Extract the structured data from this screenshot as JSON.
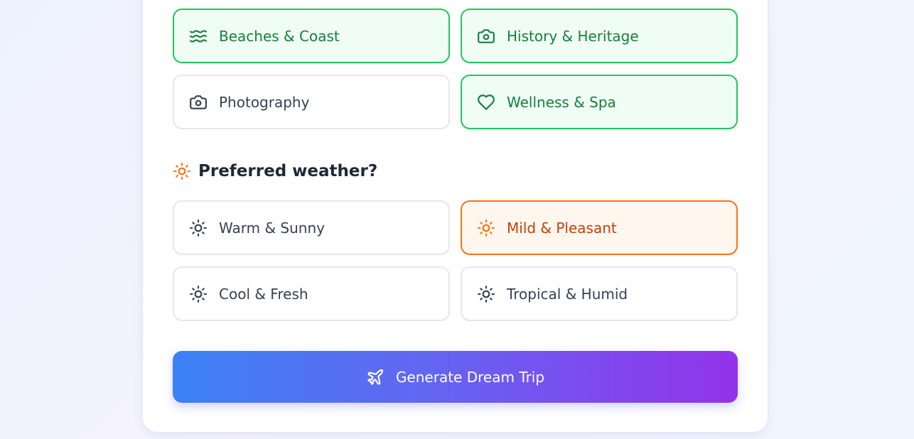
{
  "interests": [
    {
      "label": "Beaches & Coast",
      "icon": "waves-icon",
      "selected": true
    },
    {
      "label": "History & Heritage",
      "icon": "camera-icon",
      "selected": true
    },
    {
      "label": "Photography",
      "icon": "camera-icon",
      "selected": false
    },
    {
      "label": "Wellness & Spa",
      "icon": "heart-icon",
      "selected": true
    }
  ],
  "weather": {
    "heading": "Preferred weather?",
    "heading_icon": "sun-icon",
    "options": [
      {
        "label": "Warm & Sunny",
        "icon": "sun-icon",
        "selected": false
      },
      {
        "label": "Mild & Pleasant",
        "icon": "sun-icon",
        "selected": true
      },
      {
        "label": "Cool & Fresh",
        "icon": "sun-icon",
        "selected": false
      },
      {
        "label": "Tropical & Humid",
        "icon": "sun-icon",
        "selected": false
      }
    ]
  },
  "generate_button": {
    "label": "Generate Dream Trip",
    "icon": "plane-icon"
  },
  "colors": {
    "selected_green": "#22c55e",
    "selected_orange": "#f97316",
    "gradient_start": "#3b82f6",
    "gradient_end": "#9333ea"
  }
}
